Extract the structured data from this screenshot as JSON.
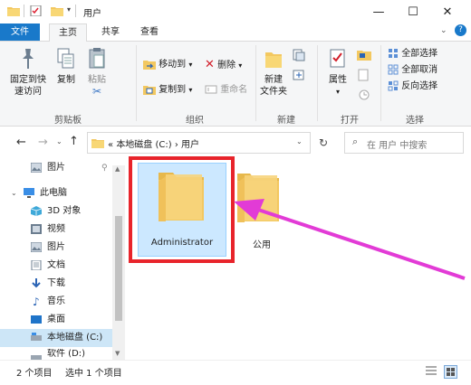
{
  "window": {
    "title": "用户",
    "minimize_glyph": "—",
    "maximize_glyph": "☐",
    "close_glyph": "✕"
  },
  "ribbon_tabs": [
    "文件",
    "主页",
    "共享",
    "查看"
  ],
  "ribbon": {
    "clipboard": {
      "pin_label_1": "固定到快",
      "pin_label_2": "速访问",
      "copy_label": "复制",
      "paste_label": "粘贴",
      "group_label": "剪贴板"
    },
    "organize": {
      "move_to": "移动到",
      "copy_to": "复制到",
      "delete": "删除",
      "rename": "重命名",
      "group_label": "组织"
    },
    "new": {
      "new_folder_1": "新建",
      "new_folder_2": "文件夹",
      "group_label": "新建"
    },
    "open": {
      "properties": "属性",
      "group_label": "打开"
    },
    "select": {
      "select_all": "全部选择",
      "select_none": "全部取消",
      "invert": "反向选择",
      "group_label": "选择"
    }
  },
  "address": {
    "crumbs_prefix": "«",
    "crumb_1": "本地磁盘 (C:)",
    "crumb_sep": "›",
    "crumb_2": "用户",
    "search_placeholder": "在 用户 中搜索"
  },
  "nav_items": [
    {
      "label": "图片",
      "icon": "pictures-icon"
    },
    {
      "label": "此电脑",
      "icon": "computer-icon"
    },
    {
      "label": "3D 对象",
      "icon": "3d-objects-icon"
    },
    {
      "label": "视频",
      "icon": "video-icon"
    },
    {
      "label": "图片",
      "icon": "pictures-icon"
    },
    {
      "label": "文档",
      "icon": "documents-icon"
    },
    {
      "label": "下载",
      "icon": "download-icon"
    },
    {
      "label": "音乐",
      "icon": "music-icon"
    },
    {
      "label": "桌面",
      "icon": "desktop-icon"
    },
    {
      "label": "本地磁盘 (C:)",
      "icon": "drive-icon"
    },
    {
      "label": "软件 (D:)",
      "icon": "drive-icon"
    }
  ],
  "folders": [
    {
      "label": "Administrator",
      "selected": true
    },
    {
      "label": "公用",
      "selected": false
    }
  ],
  "status": {
    "item_count": "2 个项目",
    "selected_count": "选中 1 个项目"
  },
  "colors": {
    "file_tab": "#1979ca",
    "highlight_box": "#e8242b",
    "arrow": "#e23bd6",
    "selection": "#cce8ff",
    "folder": "#f3c860"
  }
}
